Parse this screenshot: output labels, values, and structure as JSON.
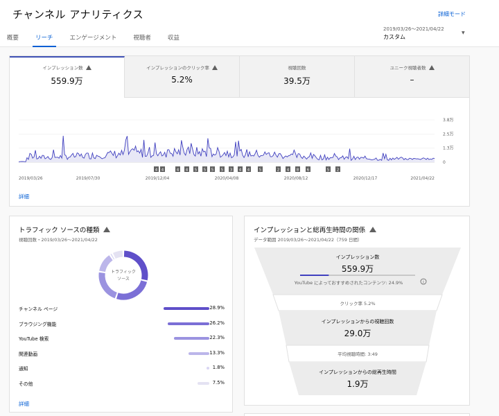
{
  "header": {
    "title": "チャンネル アナリティクス",
    "detail_mode": "詳細モード",
    "tabs": [
      {
        "label": "概要",
        "active": false
      },
      {
        "label": "リーチ",
        "active": true
      },
      {
        "label": "エンゲージメント",
        "active": false
      },
      {
        "label": "視聴者",
        "active": false
      },
      {
        "label": "収益",
        "active": false
      }
    ],
    "date_range": "2019/03/26～2021/04/22",
    "date_preset": "カスタム"
  },
  "metrics": [
    {
      "label": "インプレッション数",
      "value": "559.9万",
      "active": true,
      "warning": true
    },
    {
      "label": "インプレッションのクリック率",
      "value": "5.2%",
      "active": false,
      "warning": true
    },
    {
      "label": "視聴回数",
      "value": "39.5万",
      "active": false,
      "warning": false
    },
    {
      "label": "ユニーク視聴者数",
      "value": "–",
      "active": false,
      "warning": true
    }
  ],
  "chart_data": {
    "type": "line",
    "x_range": [
      "2019/03/26",
      "2021/04/22"
    ],
    "x_tick_labels": [
      "2019/03/26",
      "2019/07/30",
      "2019/12/04",
      "2020/04/08",
      "2020/08/12",
      "2020/12/17",
      "2021/04/22"
    ],
    "y_tick_labels": [
      "3.8万",
      "2.5万",
      "1.3万",
      "0"
    ],
    "ylim": [
      0,
      38000
    ],
    "grid": true,
    "series": [
      {
        "color": "#3f3fbf"
      }
    ],
    "markers": [
      "4",
      "4",
      "4",
      "4",
      "5",
      "5",
      "5",
      "5",
      "3",
      "4",
      "4",
      "5",
      "2",
      "4",
      "8",
      "6",
      "5",
      "2"
    ]
  },
  "reach_detail": "詳細",
  "traffic": {
    "title": "トラフィック ソースの種類",
    "subtitle": "視聴回数・2019/03/26～2021/04/22",
    "donut_label": "トラフィック ソース",
    "detail": "詳細",
    "sources": [
      {
        "label": "チャンネル ページ",
        "value": "28.9%",
        "pct": 28.9,
        "color": "#5f4fc9"
      },
      {
        "label": "ブラウジング機能",
        "value": "26.2%",
        "pct": 26.2,
        "color": "#7b6fd6"
      },
      {
        "label": "YouTube 検索",
        "value": "22.3%",
        "pct": 22.3,
        "color": "#9b93e0"
      },
      {
        "label": "関連動画",
        "value": "13.3%",
        "pct": 13.3,
        "color": "#bcb6ea"
      },
      {
        "label": "通知",
        "value": "1.8%",
        "pct": 1.8,
        "color": "#d9d6f3"
      },
      {
        "label": "その他",
        "value": "7.5%",
        "pct": 7.5,
        "color": "#e4e2f2"
      }
    ]
  },
  "funnel": {
    "title": "インプレッションと総再生時間の関係",
    "subtitle": "データ範囲 2019/03/26～2021/04/22（759 日間）",
    "impressions_label": "インプレッション数",
    "impressions_value": "559.9万",
    "recommended": "YouTube によっておすすめされたコンテンツ: 24.9%",
    "recommended_pct": 24.9,
    "ctr": "クリック率 5.2%",
    "views_label": "インプレッションからの視聴回数",
    "views_value": "29.0万",
    "avg_duration": "平均視聴時間: 3:49",
    "watch_label": "インプレッションからの総再生時間",
    "watch_value": "1.9万"
  },
  "colors": {
    "accent": "#065fd4",
    "chart": "#3f3fbf",
    "chart_fill": "#e8e8f6"
  }
}
